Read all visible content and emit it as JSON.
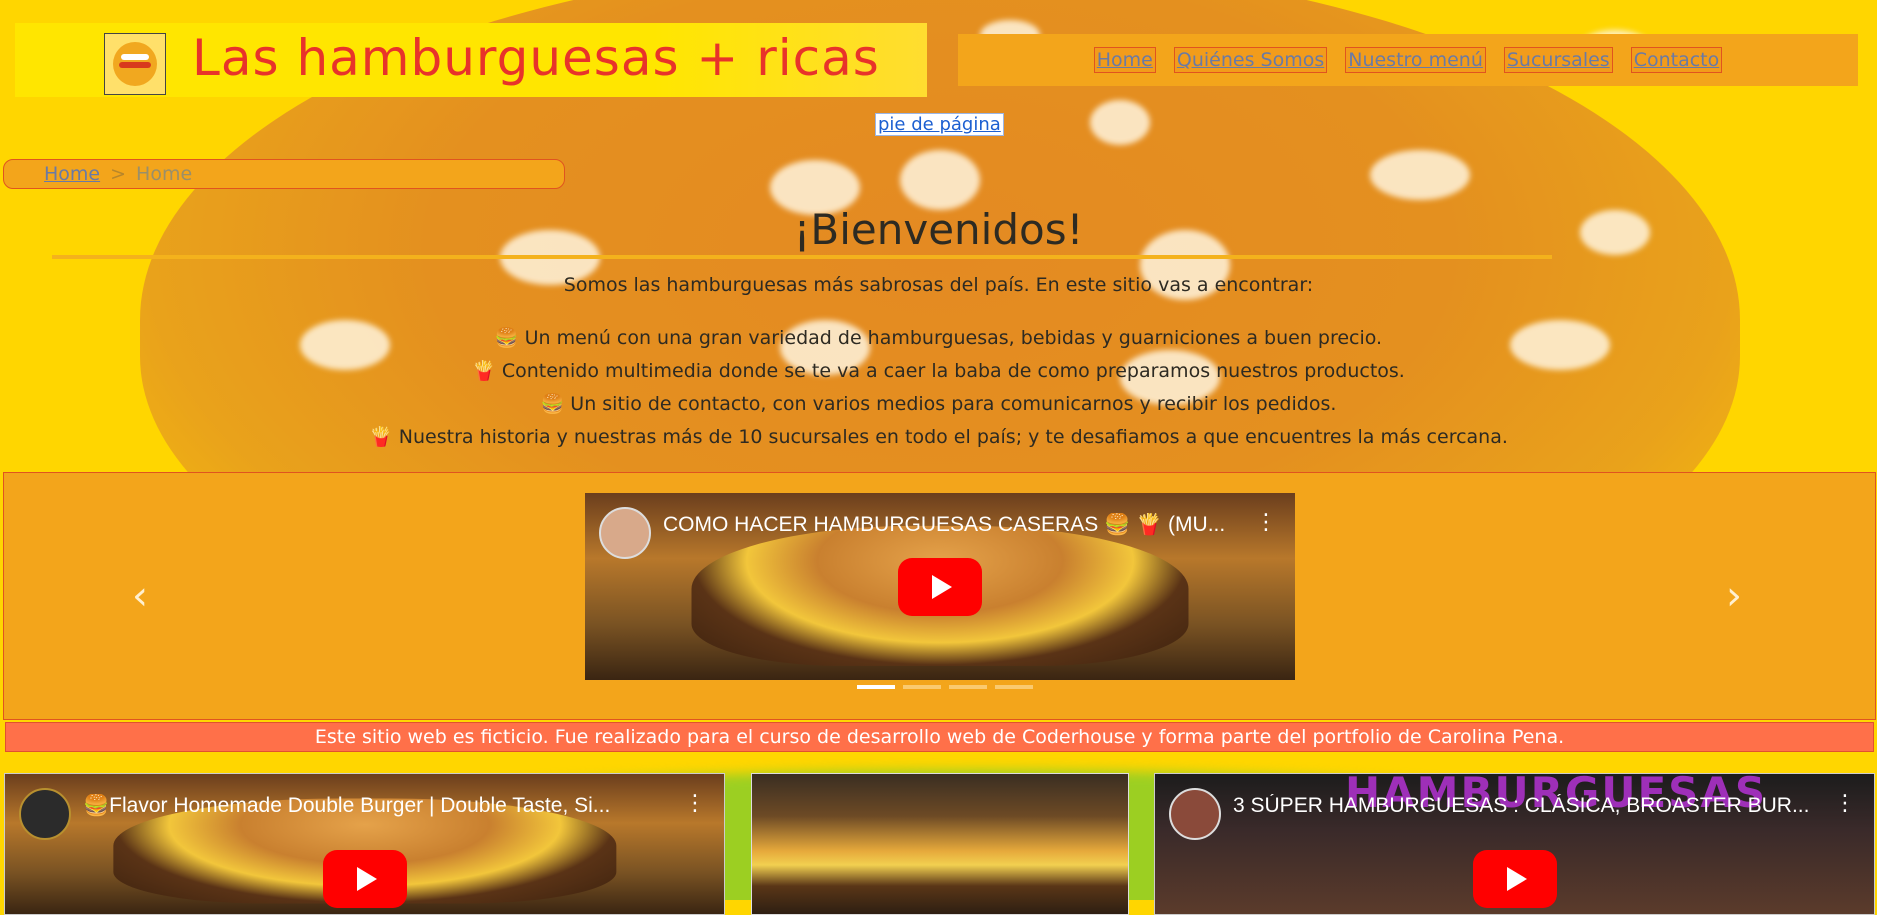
{
  "brand": {
    "title": "Las hamburguesas + ricas",
    "logo_icon": "burger-logo-icon"
  },
  "nav": {
    "items": [
      "Home",
      "Quiénes Somos",
      "Nuestro menú",
      "Sucursales",
      "Contacto"
    ]
  },
  "skip_link": "pie de página",
  "breadcrumb": {
    "link": "Home",
    "separator": ">",
    "current": "Home"
  },
  "welcome": {
    "title": "¡Bienvenidos!",
    "intro": "Somos las hamburguesas más sabrosas del país. En este sitio vas a encontrar:",
    "features": [
      {
        "icon": "🍔",
        "text": "Un menú con una gran variedad de hamburguesas, bebidas y guarniciones a buen precio."
      },
      {
        "icon": "🍟",
        "text": "Contenido multimedia donde se te va a caer la baba de como preparamos nuestros productos."
      },
      {
        "icon": "🍔",
        "text": "Un sitio de contacto, con varios medios para comunicarnos y recibir los pedidos."
      },
      {
        "icon": "🍟",
        "text": "Nuestra historia y nuestras más de 10 sucursales en todo el país; y te desafiamos a que encuentres la más cercana."
      }
    ]
  },
  "carousel": {
    "prev": "‹",
    "next": "›",
    "video_title": "COMO HACER HAMBURGUESAS CASERAS 🍔 🍟 (MU...",
    "slide_count": 4,
    "active_slide": 1
  },
  "notice": "Este sitio web es ficticio. Fue realizado para el curso de desarrollo web de Coderhouse y forma parte del portfolio de Carolina Pena.",
  "media": {
    "video1_title": "🍔Flavor Homemade Double Burger | Double Taste, Si...",
    "video2_title": "3 SÚPER HAMBURGUESAS : CLÁSICA, BROASTER BUR...",
    "video2_overlay": "HAMBURGUESAS"
  },
  "colors": {
    "accent": "#e8332a",
    "nav_bg": "#f3a51b",
    "page_bg": "#ffd600",
    "notice_bg": "#ff7049"
  }
}
